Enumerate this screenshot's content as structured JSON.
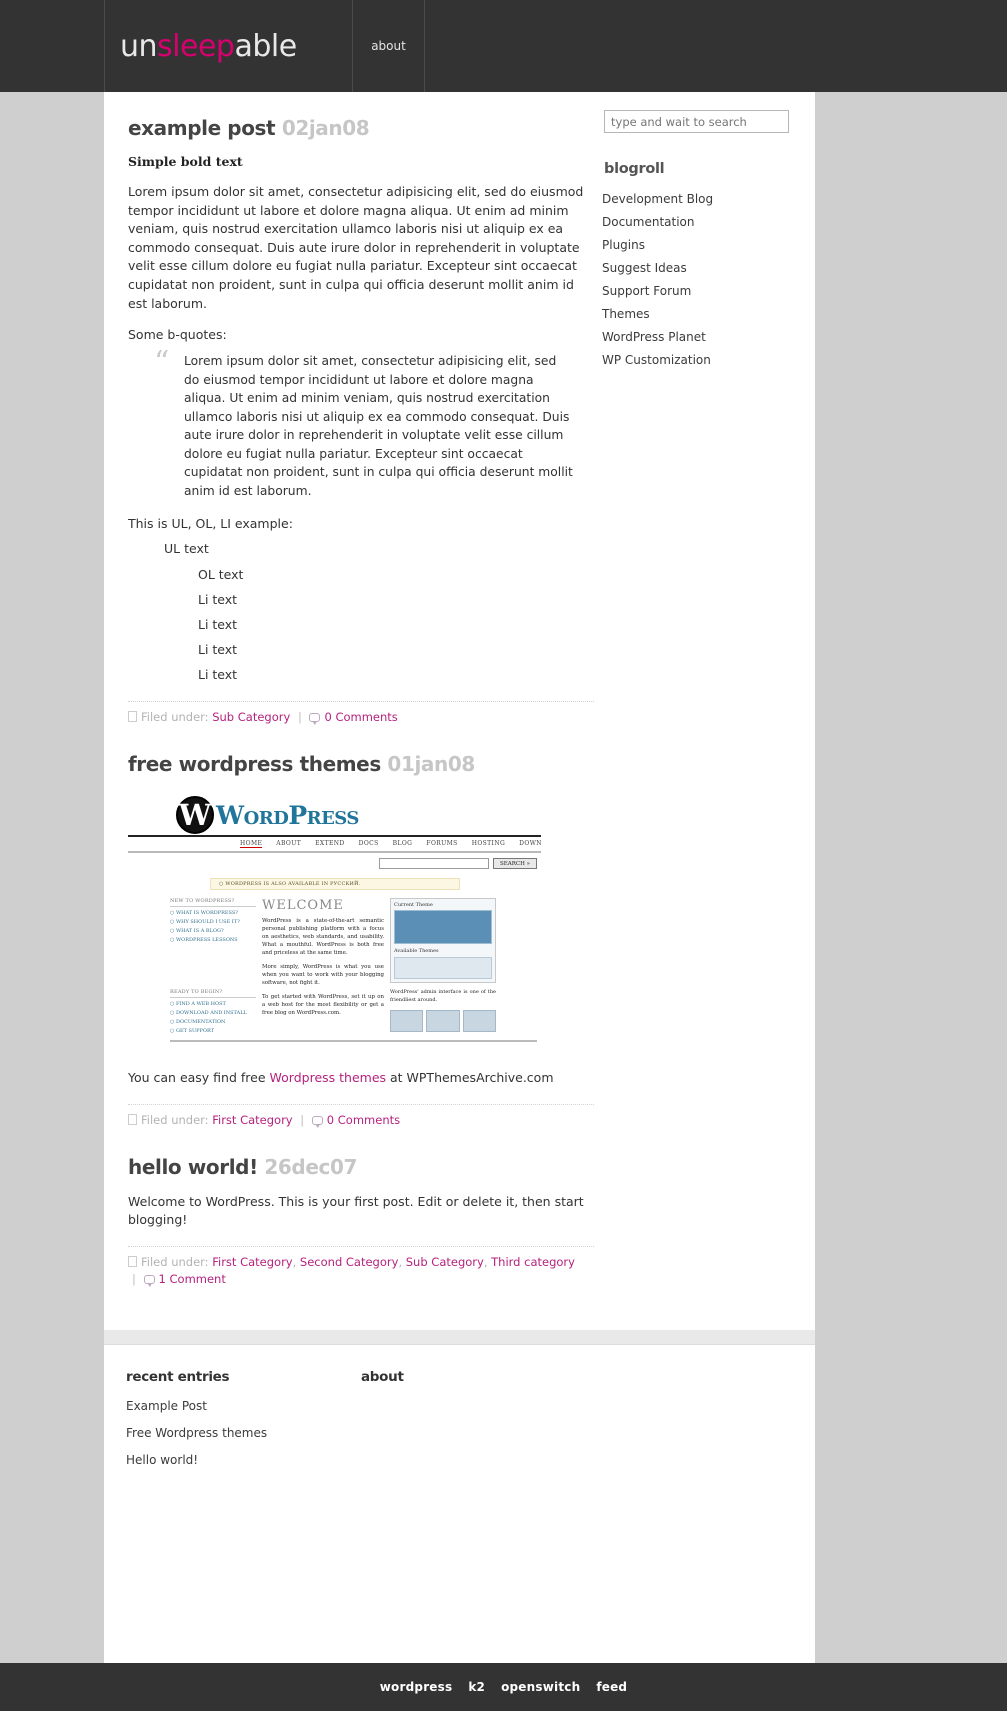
{
  "header": {
    "brand_part1": "un",
    "brand_part2": "sleep",
    "brand_part3": "able",
    "nav": [
      {
        "label": "about"
      }
    ],
    "brand_accent_color": "#d6006e",
    "background_color": "#333333"
  },
  "sidebar": {
    "search": {
      "placeholder": "type and wait to search",
      "value": ""
    },
    "blogroll": {
      "heading": "blogroll",
      "items": [
        {
          "label": "Development Blog"
        },
        {
          "label": "Documentation"
        },
        {
          "label": "Plugins"
        },
        {
          "label": "Suggest Ideas"
        },
        {
          "label": "Support Forum"
        },
        {
          "label": "Themes"
        },
        {
          "label": "WordPress Planet"
        },
        {
          "label": "WP Customization"
        }
      ]
    }
  },
  "posts": [
    {
      "title": "example post",
      "date": "02jan08",
      "bold_line": "Simple bold text",
      "paragraph": "Lorem ipsum dolor sit amet, consectetur adipisicing elit, sed do eiusmod tempor incididunt ut labore et dolore magna aliqua. Ut enim ad minim veniam, quis nostrud exercitation ullamco laboris nisi ut aliquip ex ea commodo consequat. Duis aute irure dolor in reprehenderit in voluptate velit esse cillum dolore eu fugiat nulla pariatur. Excepteur sint occaecat cupidatat non proident, sunt in culpa qui officia deserunt mollit anim id est laborum.",
      "quote_lead": "Some b-quotes:",
      "quote_mark": "“",
      "quote_text": "Lorem ipsum dolor sit amet, consectetur adipisicing elit, sed do eiusmod tempor incididunt ut labore et dolore magna aliqua. Ut enim ad minim veniam, quis nostrud exercitation ullamco laboris nisi ut aliquip ex ea commodo consequat. Duis aute irure dolor in reprehenderit in voluptate velit esse cillum dolore eu fugiat nulla pariatur. Excepteur sint occaecat cupidatat non proident, sunt in culpa qui officia deserunt mollit anim id est laborum.",
      "list_lead": "This is UL, OL, LI example:",
      "ul_items": [
        {
          "label": "UL text"
        }
      ],
      "ol_items": [
        {
          "label": "OL text"
        },
        {
          "label": "Li text"
        },
        {
          "label": "Li text"
        },
        {
          "label": "Li text"
        },
        {
          "label": "Li text"
        }
      ],
      "meta": {
        "filed_under_label": "Filed under:",
        "categories": [
          {
            "label": "Sub Category"
          }
        ],
        "separator": "|",
        "comments": "0 Comments"
      }
    },
    {
      "title": "free wordpress themes",
      "date": "01jan08",
      "body_pre": "You can easy find free ",
      "body_link": "Wordpress themes",
      "body_post": " at WPThemesArchive.com",
      "meta": {
        "filed_under_label": "Filed under:",
        "categories": [
          {
            "label": "First Category"
          }
        ],
        "separator": "|",
        "comments": "0 Comments"
      }
    },
    {
      "title": "hello world!",
      "date": "26dec07",
      "paragraph": "Welcome to WordPress. This is your first post. Edit or delete it, then start blogging!",
      "meta": {
        "filed_under_label": "Filed under:",
        "categories": [
          {
            "label": "First Category"
          },
          {
            "label": "Second Category"
          },
          {
            "label": "Sub Category"
          },
          {
            "label": "Third category"
          }
        ],
        "separator": "|",
        "comments": "1 Comment"
      }
    }
  ],
  "wp_screenshot": {
    "logo_mark": "W",
    "logo_word": "WordPress",
    "nav": [
      "HOME",
      "ABOUT",
      "EXTEND",
      "DOCS",
      "BLOG",
      "FORUMS",
      "HOSTING",
      "DOWNLOAD"
    ],
    "search_button": "SEARCH »",
    "banner": "○ WORDPRESS IS ALSO AVAILABLE IN РУССКИЙ.",
    "left_col": {
      "heading": "NEW TO WORDPRESS?",
      "items": [
        "○ WHAT IS WORDPRESS?",
        "○ WHY SHOULD I USE IT?",
        "○ WHAT IS A BLOG?",
        "○ WORDPRESS LESSONS"
      ],
      "heading2": "READY TO BEGIN?",
      "items2": [
        "○ FIND A WEB HOST",
        "○ DOWNLOAD AND INSTALL",
        "○ DOCUMENTATION",
        "○ GET SUPPORT"
      ]
    },
    "welcome": "WELCOME",
    "para1": "WordPress is a state-of-the-art semantic personal publishing platform with a focus on aesthetics, web standards, and usability. What a mouthful. WordPress is both free and priceless at the same time.",
    "para2": "More simply, WordPress is what you use when you want to work with your blogging software, not fight it.",
    "para3": "To get started with WordPress, set it up on a web host for the most flexibility or get a free blog on WordPress.com.",
    "right_col": {
      "heading": "Current Theme",
      "heading2": "Available Themes",
      "caption": "WordPress' admin interface is one of the friendliest around."
    }
  },
  "footer_widgets": {
    "recent_entries": {
      "heading": "recent entries",
      "items": [
        {
          "label": "Example Post"
        },
        {
          "label": "Free Wordpress themes"
        },
        {
          "label": "Hello world!"
        }
      ]
    },
    "about": {
      "heading": "about"
    }
  },
  "bottom_bar": {
    "links": [
      {
        "label": "wordpress"
      },
      {
        "label": "k2"
      },
      {
        "label": "openswitch"
      },
      {
        "label": "feed"
      }
    ]
  }
}
